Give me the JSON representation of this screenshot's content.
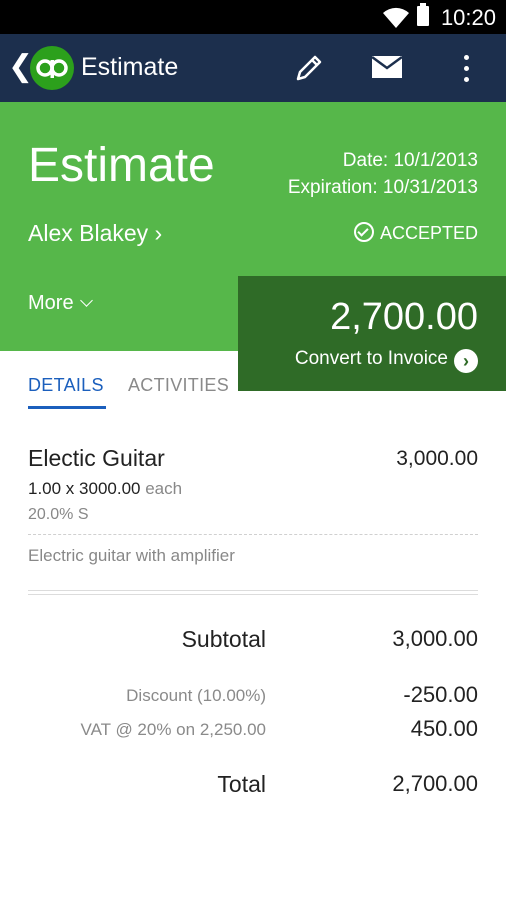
{
  "status_bar": {
    "time": "10:20"
  },
  "appbar": {
    "back_glyph": "❮",
    "title": "Estimate",
    "icons": [
      "qb-logo-icon",
      "pencil-icon",
      "mail-icon",
      "overflow-menu-icon"
    ]
  },
  "header": {
    "title": "Estimate",
    "date": "Date: 10/1/2013",
    "expiration": "Expiration: 10/31/2013",
    "customer": "Alex Blakey ›",
    "status": "ACCEPTED",
    "more": "More",
    "amount": "2,700.00",
    "convert": "Convert to Invoice",
    "convert_arrow": "›"
  },
  "tabs": [
    {
      "label": "DETAILS",
      "active": true
    },
    {
      "label": "ACTIVITIES",
      "active": false
    }
  ],
  "line_item": {
    "name": "Electic Guitar",
    "amount": "3,000.00",
    "qty": "1.00 x 3000.00",
    "each": "each",
    "tax": "20.0% S",
    "description": "Electric guitar with amplifier"
  },
  "summary": {
    "subtotal_label": "Subtotal",
    "subtotal_value": "3,000.00",
    "discount_label": "Discount (10.00%)",
    "discount_value": "-250.00",
    "vat_label": "VAT @ 20% on 2,250.00",
    "vat_value": "450.00",
    "total_label": "Total",
    "total_value": "2,700.00"
  },
  "colors": {
    "appbar": "#1c2f4d",
    "hero": "#56b74a",
    "amount_card": "#2f6b27",
    "accent_tab": "#1b5fbd",
    "logo": "#2ca01c"
  }
}
